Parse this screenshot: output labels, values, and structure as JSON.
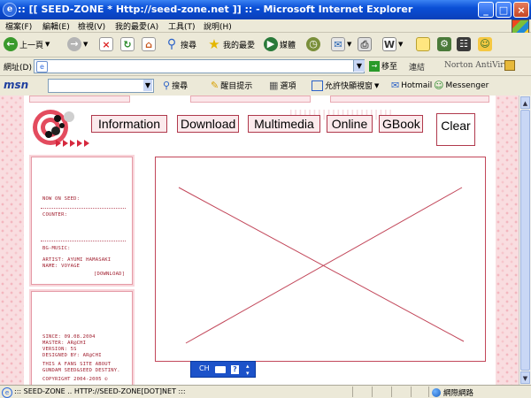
{
  "window": {
    "title": ":: [[ SEED-ZONE * Http://seed-zone.net ]] :: - Microsoft Internet Explorer",
    "minimize": "_",
    "maximize": "□",
    "close": "×"
  },
  "menu": [
    "檔案(F)",
    "編輯(E)",
    "檢視(V)",
    "我的最愛(A)",
    "工具(T)",
    "說明(H)"
  ],
  "toolbar": {
    "back": "上一頁",
    "search": "搜尋",
    "favorites": "我的最愛",
    "media": "媒體"
  },
  "address": {
    "label": "網址(D)",
    "value": "",
    "go": "移至",
    "links": "連結",
    "norton": "Norton AntiVirus"
  },
  "msnbar": {
    "logo": "msn",
    "search": "搜尋",
    "highlight": "醒目提示",
    "options": "選項",
    "popup": "允許快顯視窗",
    "hotmail": "Hotmail",
    "messenger": "Messenger"
  },
  "site": {
    "nav": [
      "Information",
      "Download",
      "Multimedia",
      "Online",
      "GBook",
      "Clear"
    ],
    "sidebar1": {
      "now_on_seed": "NOW ON SEED:",
      "counter": "COUNTER:",
      "bg_music": "BG-MUSIC:",
      "artist": "ARTIST: AYUMI HAMASAKI",
      "name": "NAME: VOYAGE",
      "download": "[DOWNLOAD]"
    },
    "sidebar2": {
      "since": "SINCE: 09.08.2004",
      "master": "MASTER: AR@CHI",
      "version": "VERSION: 5S",
      "designed": "DESIGNED BY: AR@CHI",
      "fans1": "THIS A FANS SITE ABOUT",
      "fans2": "GUNDAM SEED&SEED DESTINY.",
      "copyright": "COPYRIGHT 2004-2005 ©"
    }
  },
  "langbar": {
    "lang": "CH"
  },
  "status": {
    "text": "::: SEED-ZONE .. HTTP://SEED-ZONE[DOT]NET  :::",
    "zone": "網際網路"
  },
  "colors": {
    "accent": "#c2475a",
    "pink_bg": "#f9dde0",
    "xp_blue": "#0a4fd6"
  }
}
